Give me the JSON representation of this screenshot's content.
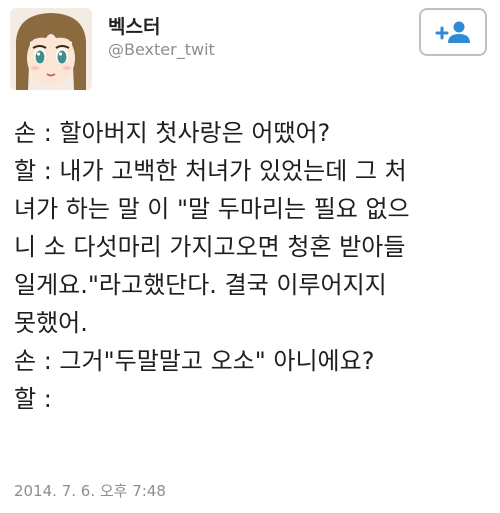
{
  "profile": {
    "display_name": "벡스터",
    "handle": "@Bexter_twit"
  },
  "follow_button": {
    "icon": "add-person-icon",
    "color": "#2f8bd6"
  },
  "tweet": {
    "lines": [
      "손 : 할아버지 첫사랑은 어땠어?",
      "할 : 내가 고백한 처녀가 있었는데 그 처",
      "녀가 하는 말 이 \"말 두마리는 필요 없으",
      "니 소 다섯마리 가지고오면 청혼 받아들",
      "일게요.\"라고했단다. 결국 이루어지지",
      "못했어.",
      "손 : 그거\"두말말고 오소\" 아니에요?",
      "할 :"
    ],
    "timestamp": "2014. 7. 6. 오후 7:48"
  }
}
